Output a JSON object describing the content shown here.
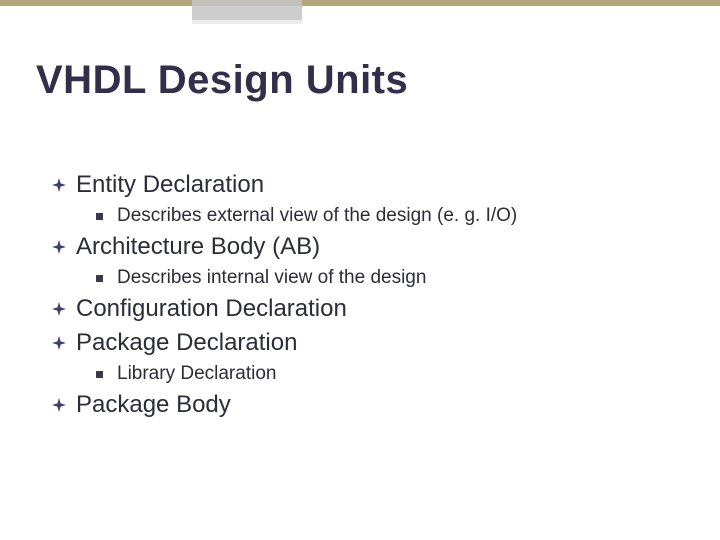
{
  "title": "VHDL Design Units",
  "items": [
    {
      "text": "Entity Declaration",
      "children": [
        {
          "text": "Describes external view of the design (e. g. I/O)"
        }
      ]
    },
    {
      "text": "Architecture Body (AB)",
      "children": [
        {
          "text": "Describes internal view of the design"
        }
      ]
    },
    {
      "text": "Configuration Declaration",
      "children": []
    },
    {
      "text": "Package Declaration",
      "children": [
        {
          "text": "Library Declaration"
        }
      ]
    },
    {
      "text": "Package Body",
      "children": []
    }
  ]
}
